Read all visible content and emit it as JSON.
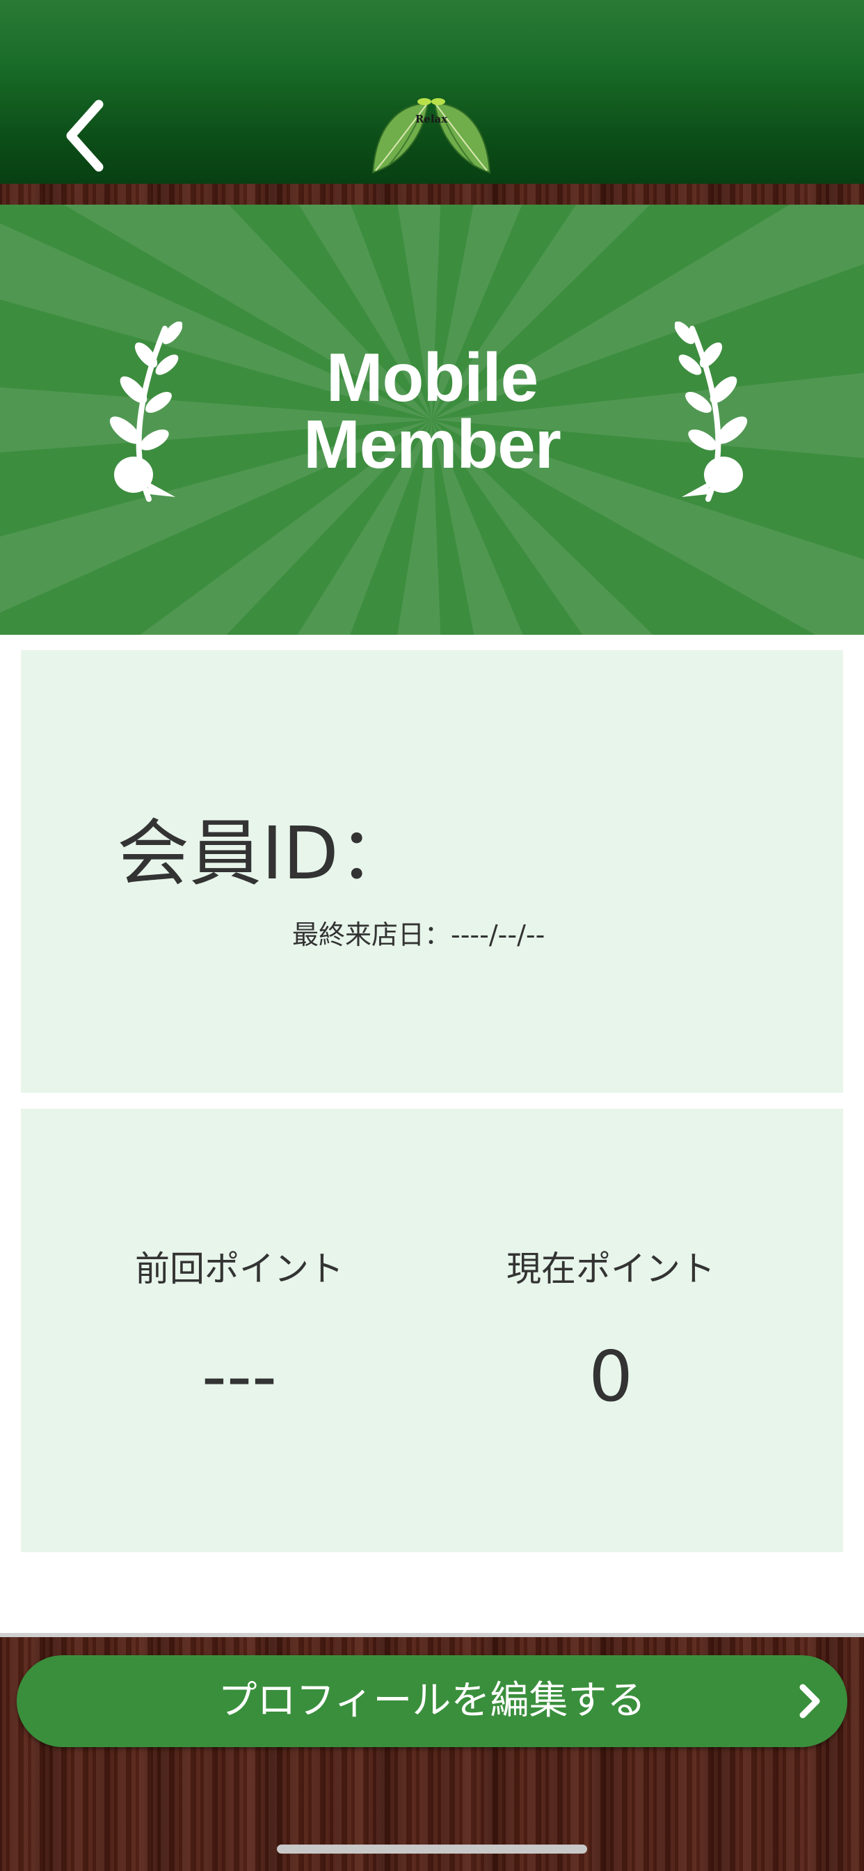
{
  "header": {
    "logo_text": "Relax",
    "back_icon": "chevron-left-icon"
  },
  "banner": {
    "title_line1": "Mobile",
    "title_line2": "Member",
    "left_icon": "laurel-branch-icon",
    "right_icon": "laurel-branch-icon"
  },
  "member_card": {
    "id_label": "会員ID：",
    "last_visit": "最終来店日：----/--/--"
  },
  "points_card": {
    "previous_label": "前回ポイント",
    "previous_value": "---",
    "current_label": "現在ポイント",
    "current_value": "0"
  },
  "footer": {
    "edit_profile_label": "プロフィールを編集する",
    "edit_icon": "chevron-right-icon"
  },
  "colors": {
    "header_green": "#196c28",
    "banner_green": "#3d8d3f",
    "card_bg": "#e7f5ea",
    "button_green": "#3a8f3c",
    "wood_brown": "#4b1c12",
    "text_dark": "#333333"
  }
}
